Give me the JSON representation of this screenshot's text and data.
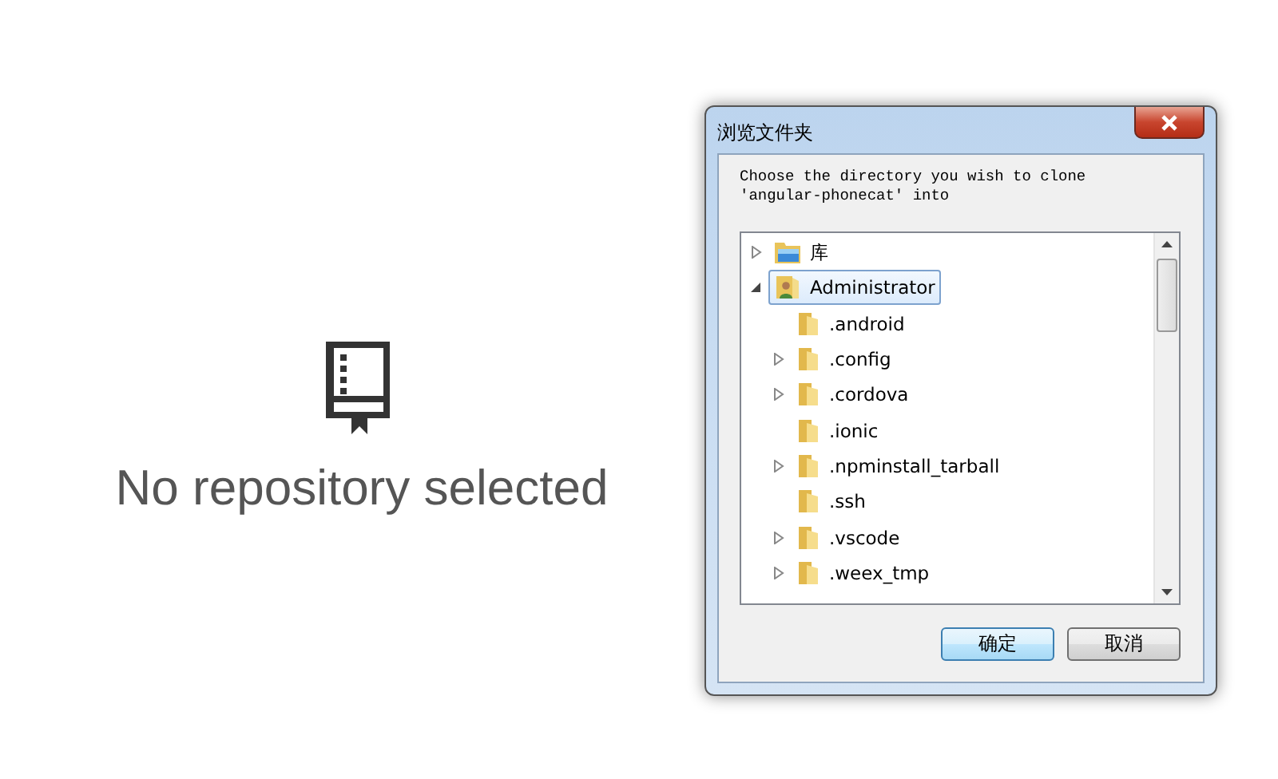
{
  "empty_state": {
    "message": "No repository selected"
  },
  "dialog": {
    "title": "浏览文件夹",
    "prompt": "Choose the directory you wish to clone\n'angular-phonecat' into",
    "tree": [
      {
        "label": "库",
        "kind": "library",
        "expanded": false,
        "selected": false
      },
      {
        "label": "Administrator",
        "kind": "user",
        "expanded": true,
        "selected": true,
        "children": [
          {
            "label": ".android",
            "kind": "folder",
            "selected": false
          },
          {
            "label": ".config",
            "kind": "folder",
            "expanded": false,
            "selected": false
          },
          {
            "label": ".cordova",
            "kind": "folder",
            "expanded": false,
            "selected": false
          },
          {
            "label": ".ionic",
            "kind": "folder",
            "selected": false
          },
          {
            "label": ".npminstall_tarball",
            "kind": "folder",
            "expanded": false,
            "selected": false
          },
          {
            "label": ".ssh",
            "kind": "folder",
            "selected": false
          },
          {
            "label": ".vscode",
            "kind": "folder",
            "expanded": false,
            "selected": false
          },
          {
            "label": ".weex_tmp",
            "kind": "folder",
            "expanded": false,
            "selected": false
          }
        ]
      }
    ],
    "buttons": [
      {
        "label": "确定",
        "default": true
      },
      {
        "label": "取消",
        "default": false
      }
    ]
  }
}
